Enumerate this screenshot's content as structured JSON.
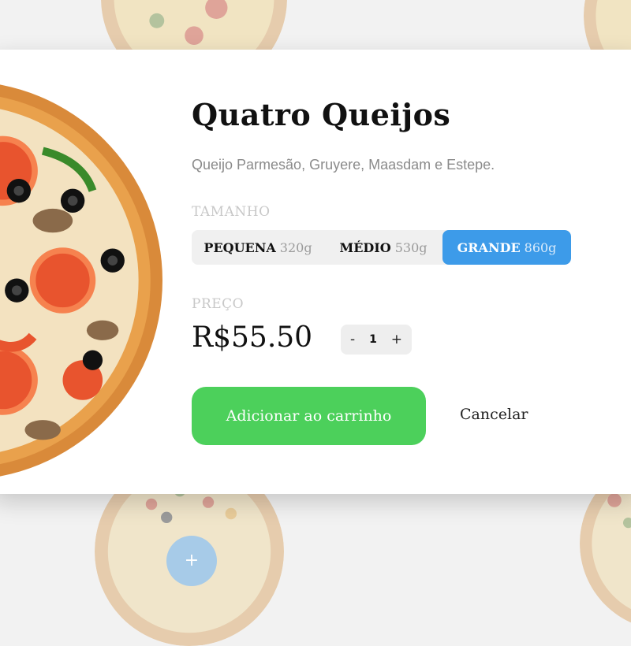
{
  "product": {
    "title": "Quatro Queijos",
    "description": "Queijo Parmesão, Gruyere, Maasdam e Estepe."
  },
  "size_section": {
    "label": "TAMANHO",
    "selected": "GRANDE",
    "options": [
      {
        "name": "PEQUENA",
        "weight": "320g"
      },
      {
        "name": "MÉDIO",
        "weight": "530g"
      },
      {
        "name": "GRANDE",
        "weight": "860g"
      }
    ]
  },
  "price_section": {
    "label": "PREÇO",
    "value": "R$55.50"
  },
  "quantity": {
    "decrement": "-",
    "value": "1",
    "increment": "+"
  },
  "actions": {
    "add_to_cart": "Adicionar ao carrinho",
    "cancel": "Cancelar"
  },
  "background": {
    "add_button": "+"
  },
  "colors": {
    "accent_blue": "#3d9be9",
    "add_green": "#4cd05b"
  },
  "icons": [
    "pizza-image",
    "plus-icon"
  ]
}
